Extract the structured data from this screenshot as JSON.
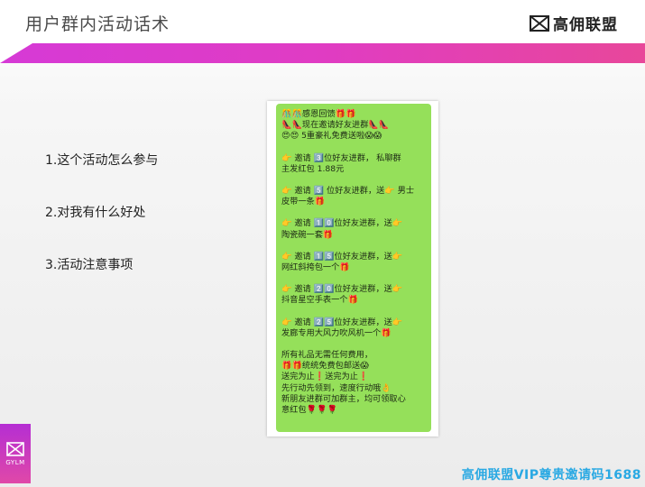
{
  "header": {
    "title": "用户群内活动话术",
    "logo_text": "高佣联盟"
  },
  "questions": [
    "1.这个活动怎么参与",
    "2.对我有什么好处",
    "3.活动注意事项"
  ],
  "message": {
    "lines": [
      "🎊🎊感恩回馈🎁🎁",
      "👠👠现在邀请好友进群👠👠",
      "😍😍 5重豪礼免费送啦😱😱",
      "",
      "👉 邀请 3️⃣位好友进群，  私聊群",
      "主发红包 1.88元",
      "",
      "👉 邀请 5️⃣ 位好友进群，送👉 男士",
      "皮带一条🎁",
      "",
      "👉 邀请 1️⃣0️⃣位好友进群，送👉",
      "陶瓷碗一套🎁",
      "",
      "👉 邀请 1️⃣5️⃣位好友进群，送👉",
      "网红斜挎包一个🎁",
      "",
      "👉 邀请 2️⃣0️⃣位好友进群，送👉",
      "抖音星空手表一个🎁",
      "",
      "👉 邀请 2️⃣5️⃣位好友进群，送👉",
      "发廊专用大风力吹风机一个🎁",
      "",
      "所有礼品无需任何费用，",
      "🎁🎁统统免费包邮送😱",
      "送完为止❗送完为止❗",
      "先行动先领到，速度行动哦👌",
      "新朋友进群可加群主，均可领取心",
      "意红包🌹🌹🌹"
    ]
  },
  "badge": {
    "text": "GYLM"
  },
  "watermark": "高佣联盟VIP尊贵邀请码1688"
}
